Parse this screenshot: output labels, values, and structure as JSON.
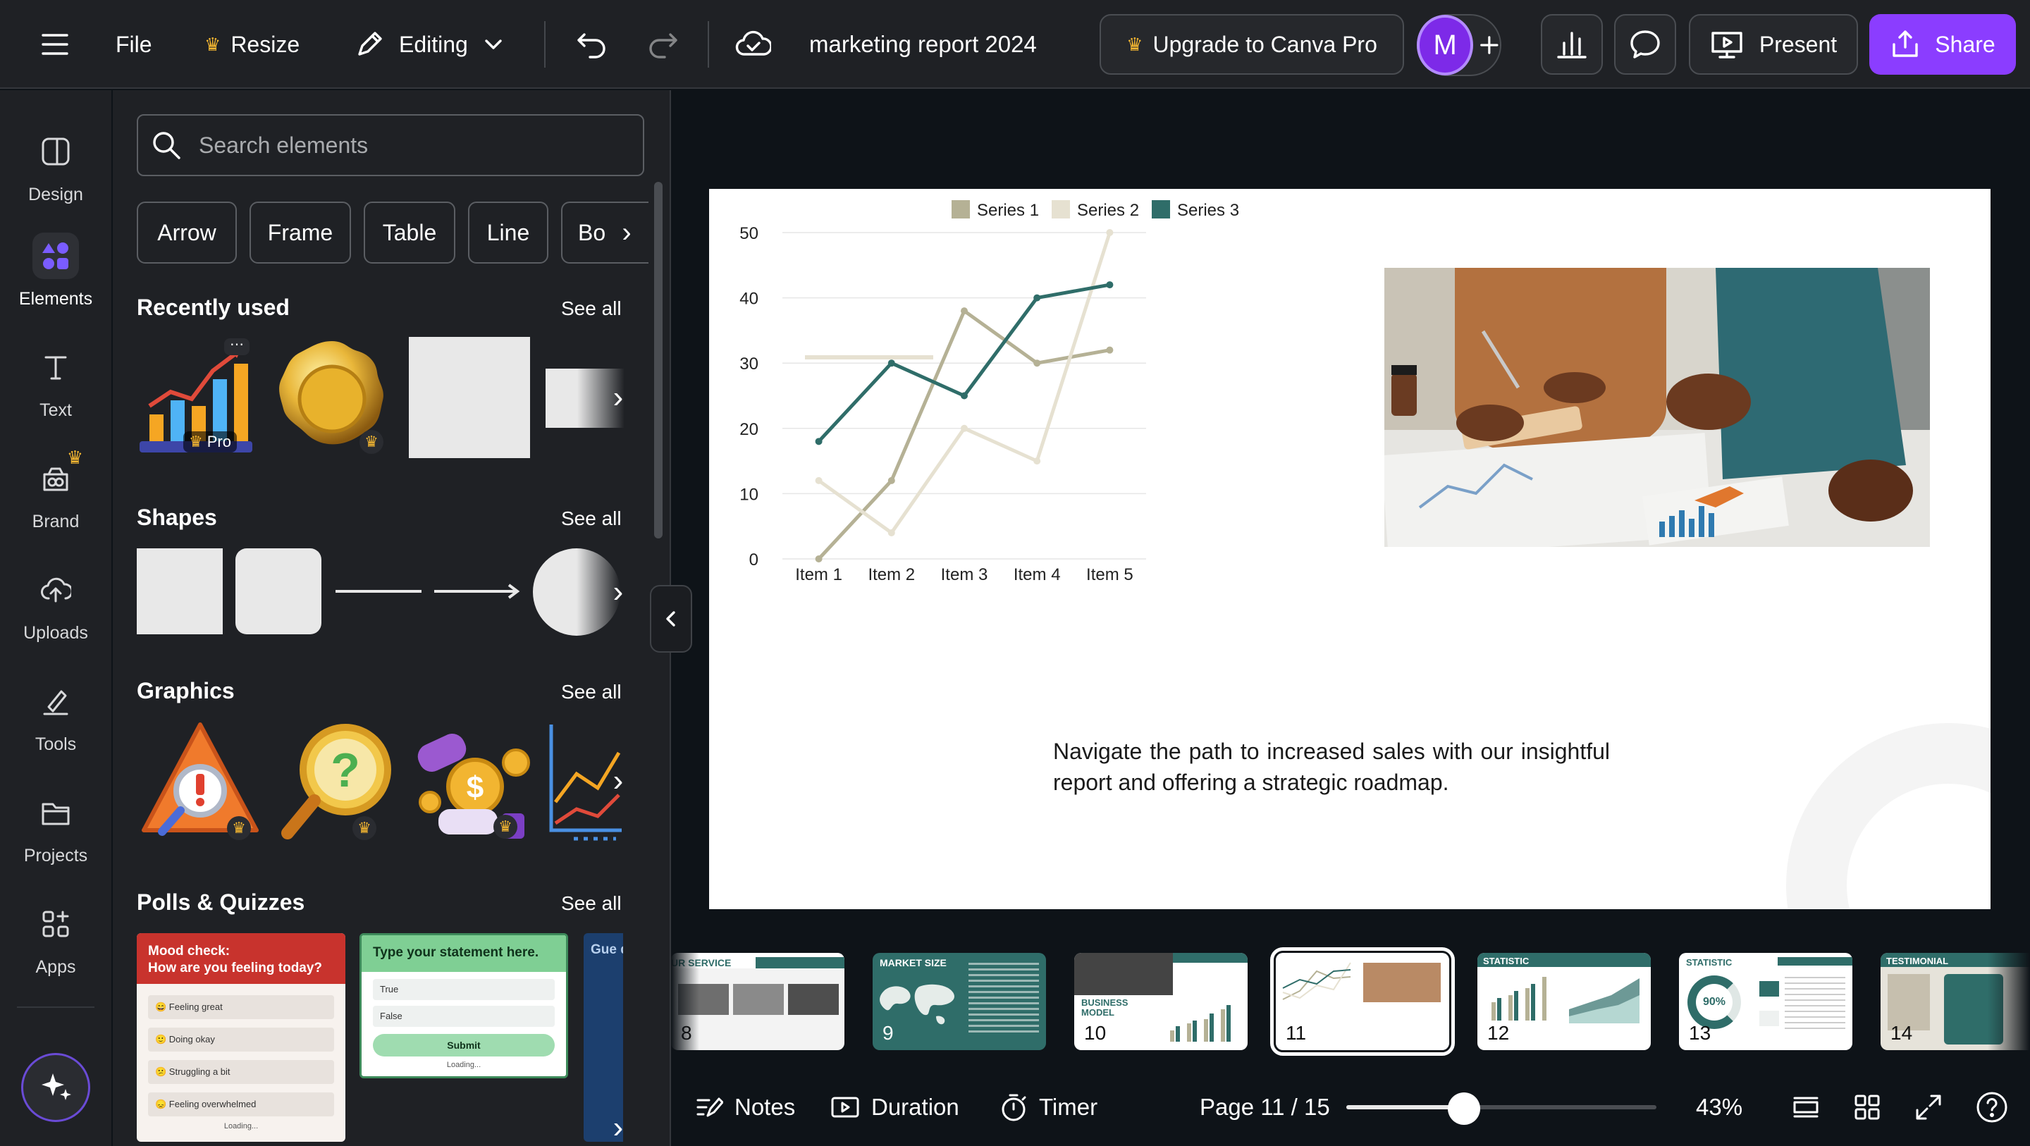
{
  "topbar": {
    "file": "File",
    "resize": "Resize",
    "editing": "Editing",
    "doc_title": "marketing report 2024",
    "upgrade": "Upgrade to Canva Pro",
    "avatar": "M",
    "present": "Present",
    "share": "Share"
  },
  "rail": {
    "items": [
      {
        "label": "Design",
        "icon": "design-icon"
      },
      {
        "label": "Elements",
        "icon": "elements-icon"
      },
      {
        "label": "Text",
        "icon": "text-icon"
      },
      {
        "label": "Brand",
        "icon": "brand-icon"
      },
      {
        "label": "Uploads",
        "icon": "upload-icon"
      },
      {
        "label": "Tools",
        "icon": "tools-icon"
      },
      {
        "label": "Projects",
        "icon": "folder-icon"
      },
      {
        "label": "Apps",
        "icon": "apps-icon"
      }
    ]
  },
  "panel": {
    "search_placeholder": "Search elements",
    "chips": [
      "Arrow",
      "Frame",
      "Table",
      "Line",
      "Bo"
    ],
    "see_all": "See all",
    "sections": {
      "recent": "Recently used",
      "shapes": "Shapes",
      "graphics": "Graphics",
      "polls": "Polls & Quizzes"
    },
    "pro_badge": "Pro",
    "poll1": {
      "title_line1": "Mood check:",
      "title_line2": "How are you feeling today?",
      "options": [
        "😄 Feeling great",
        "🙂 Doing okay",
        "😕 Struggling a bit",
        "😞 Feeling overwhelmed"
      ],
      "loading": "Loading..."
    },
    "poll2": {
      "title": "Type your statement here.",
      "options": [
        "True",
        "False"
      ],
      "submit": "Submit",
      "loading": "Loading..."
    },
    "poll3": {
      "title": "Gue que"
    }
  },
  "slide": {
    "body_text": "Navigate the path to increased sales with our insightful report and offering a strategic roadmap."
  },
  "chart_data": {
    "type": "line",
    "categories": [
      "Item 1",
      "Item 2",
      "Item 3",
      "Item 4",
      "Item 5"
    ],
    "series": [
      {
        "name": "Series 1",
        "values": [
          0,
          12,
          38,
          30,
          32
        ],
        "color": "#b5b195"
      },
      {
        "name": "Series 2",
        "values": [
          12,
          4,
          20,
          15,
          50
        ],
        "color": "#e6e1d1"
      },
      {
        "name": "Series 3",
        "values": [
          18,
          30,
          25,
          40,
          42
        ],
        "color": "#2f6d69"
      }
    ],
    "yticks": [
      "0",
      "10",
      "20",
      "30",
      "40",
      "50"
    ],
    "ylim": [
      0,
      50
    ],
    "legend": "top"
  },
  "filmstrip": {
    "pages": [
      {
        "num": "8",
        "label": "UR SERVICE"
      },
      {
        "num": "9",
        "label": "MARKET SIZE"
      },
      {
        "num": "10",
        "label": "BUSINESS MODEL"
      },
      {
        "num": "11",
        "label": ""
      },
      {
        "num": "12",
        "label": "STATISTIC"
      },
      {
        "num": "13",
        "label": "STATISTIC",
        "stat": "90%"
      },
      {
        "num": "14",
        "label": "TESTIMONIAL"
      }
    ]
  },
  "bottombar": {
    "notes": "Notes",
    "duration": "Duration",
    "timer": "Timer",
    "page": "Page 11 / 15",
    "zoom": "43%",
    "zoom_fraction": 0.38
  },
  "colors": {
    "accent_purple": "#8b3dff",
    "teal": "#2f6d69",
    "dark_bg": "#1f2125"
  }
}
